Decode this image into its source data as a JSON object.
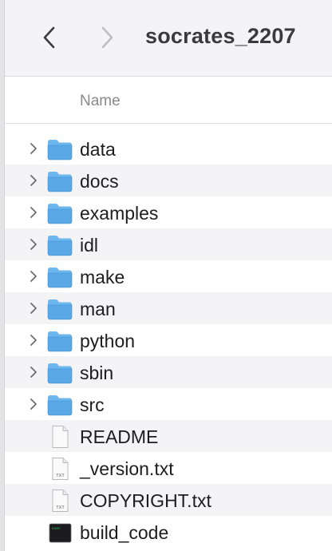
{
  "toolbar": {
    "title": "socrates_2207"
  },
  "header": {
    "name_col": "Name"
  },
  "colors": {
    "folder": "#5aa8e6",
    "folder_tab": "#6db6ee",
    "folder_edge": "#3f8fd2",
    "chevron": "#6e6e73",
    "alt_row": "#f4f4f6"
  },
  "files": [
    {
      "name": "data",
      "kind": "folder",
      "icon": "folder-icon"
    },
    {
      "name": "docs",
      "kind": "folder",
      "icon": "folder-icon"
    },
    {
      "name": "examples",
      "kind": "folder",
      "icon": "folder-icon"
    },
    {
      "name": "idl",
      "kind": "folder",
      "icon": "folder-icon"
    },
    {
      "name": "make",
      "kind": "folder",
      "icon": "folder-icon"
    },
    {
      "name": "man",
      "kind": "folder",
      "icon": "folder-icon"
    },
    {
      "name": "python",
      "kind": "folder",
      "icon": "folder-icon"
    },
    {
      "name": "sbin",
      "kind": "folder",
      "icon": "folder-icon"
    },
    {
      "name": "src",
      "kind": "folder",
      "icon": "folder-icon"
    },
    {
      "name": "README",
      "kind": "document",
      "icon": "document-icon"
    },
    {
      "name": "_version.txt",
      "kind": "text",
      "icon": "txt-file-icon",
      "badge": "TXT"
    },
    {
      "name": "COPYRIGHT.txt",
      "kind": "text",
      "icon": "txt-file-icon",
      "badge": "TXT"
    },
    {
      "name": "build_code",
      "kind": "executable",
      "icon": "terminal-exec-icon",
      "badge": "exec"
    }
  ]
}
